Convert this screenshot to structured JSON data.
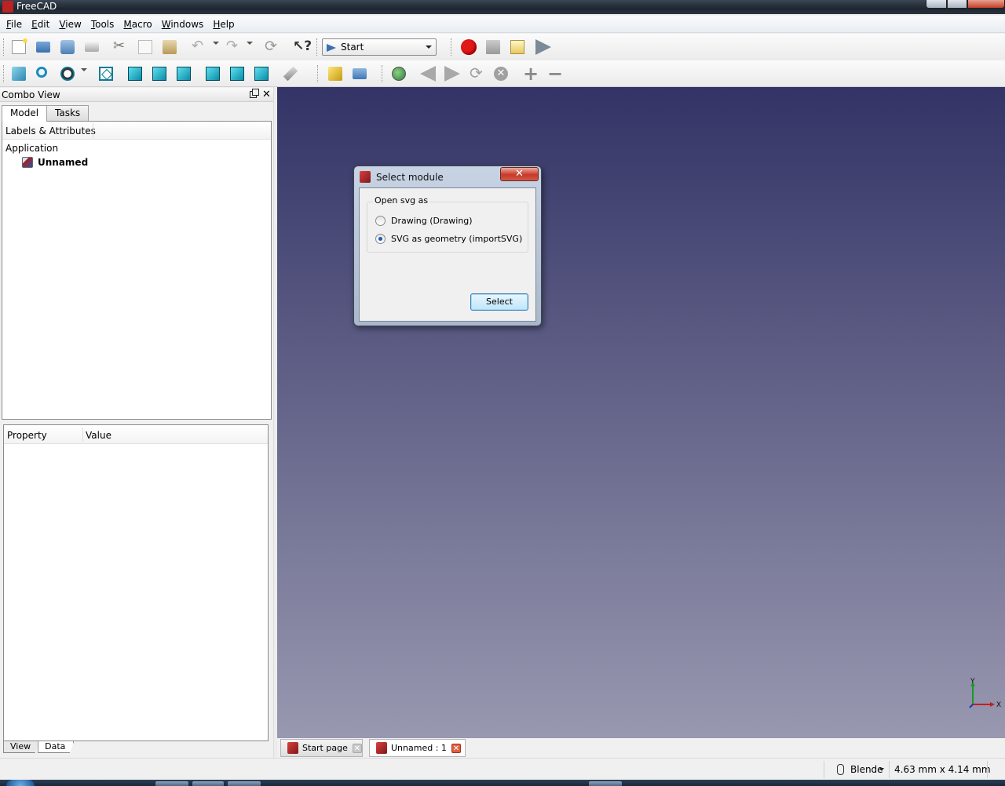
{
  "window": {
    "title": "FreeCAD"
  },
  "menubar": {
    "items": [
      "File",
      "Edit",
      "View",
      "Tools",
      "Macro",
      "Windows",
      "Help"
    ]
  },
  "toolbar": {
    "workbench_selected": "Start",
    "icons_row1": [
      "new-document-icon",
      "open-icon",
      "save-icon",
      "print-icon",
      "cut-icon",
      "copy-icon",
      "paste-icon",
      "undo-icon",
      "redo-icon",
      "refresh-icon",
      "whats-this-icon",
      "record-macro-icon",
      "stop-macro-icon",
      "edit-macro-icon",
      "execute-macro-icon"
    ],
    "icons_row2": [
      "fit-all-icon",
      "fit-selection-icon",
      "draw-style-icon",
      "isometric-view-icon",
      "front-view-icon",
      "top-view-icon",
      "right-view-icon",
      "rear-view-icon",
      "bottom-view-icon",
      "left-view-icon",
      "measure-distance-icon",
      "create-part-icon",
      "create-group-icon",
      "web-icon",
      "back-icon",
      "forward-icon",
      "reload-icon",
      "stop-loading-icon",
      "zoom-in-icon",
      "zoom-out-icon"
    ]
  },
  "combo_view": {
    "title": "Combo View",
    "tabs": [
      {
        "label": "Model",
        "active": true
      },
      {
        "label": "Tasks",
        "active": false
      }
    ],
    "tree": {
      "header": "Labels & Attributes",
      "root": "Application",
      "document": "Unnamed"
    },
    "property_editor": {
      "columns": [
        "Property",
        "Value"
      ],
      "tabs": [
        {
          "label": "View",
          "active": false
        },
        {
          "label": "Data",
          "active": true
        }
      ]
    }
  },
  "dialog": {
    "title": "Select module",
    "close_label": "✕",
    "group_title": "Open svg as",
    "options": [
      {
        "label": "Drawing (Drawing)",
        "selected": false
      },
      {
        "label": "SVG as geometry (importSVG)",
        "selected": true
      }
    ],
    "button_label": "Select"
  },
  "axis_labels": {
    "y": "Y",
    "x": "X"
  },
  "document_tabs": [
    {
      "label": "Start page",
      "active": false
    },
    {
      "label": "Unnamed : 1",
      "active": true
    }
  ],
  "statusbar": {
    "navigation_style": "Blende",
    "dimensions": "4.63 mm x 4.14 mm"
  },
  "colors": {
    "view_top": "#333366",
    "view_bottom": "#9898b0",
    "record": "#e01818",
    "accent": "#3c7fb1"
  }
}
